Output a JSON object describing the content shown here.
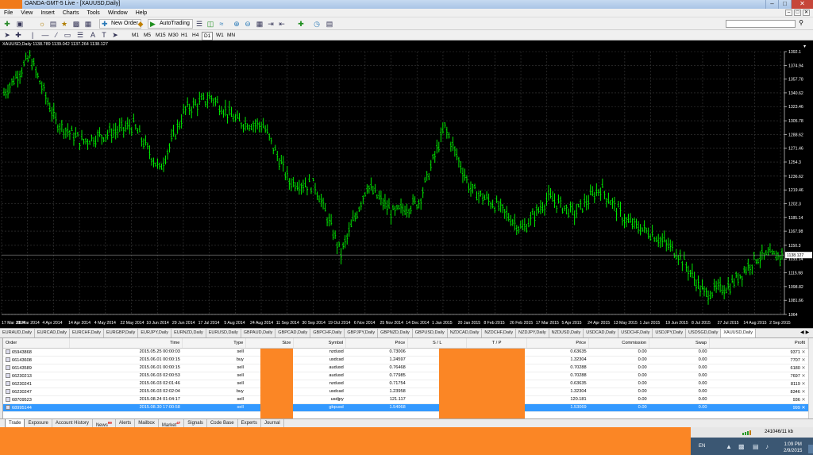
{
  "window": {
    "title": "OANDA-GMT-5 Live - [XAUUSD,Daily]"
  },
  "menu": [
    "File",
    "View",
    "Insert",
    "Charts",
    "Tools",
    "Window",
    "Help"
  ],
  "toolbar": {
    "new_order": "New Order",
    "auto_trading": "AutoTrading",
    "timeframes": [
      "M1",
      "M5",
      "M15",
      "M30",
      "H1",
      "H4",
      "D1",
      "W1",
      "MN"
    ],
    "drawing_tools": [
      "A",
      "T"
    ]
  },
  "chart": {
    "header": "XAUUSD,Daily  1138.789 1139.042 1137.264 1138.127",
    "current_price_label": "1138.127",
    "colors": {
      "background": "#000000",
      "bars": "#00ff00",
      "grid": "#3a3a3a",
      "text": "#ffffff"
    }
  },
  "chart_data": {
    "type": "line",
    "ylim": [
      1064.0,
      1392.1
    ],
    "y_ticks": [
      1392.1,
      1374.94,
      1357.78,
      1340.62,
      1323.46,
      1305.78,
      1288.62,
      1271.46,
      1254.3,
      1236.62,
      1219.46,
      1202.3,
      1185.14,
      1167.98,
      1150.3,
      1133.14,
      1115.98,
      1098.82,
      1081.66,
      1064.0
    ],
    "x_ticks": [
      "17 Mar 2014",
      "26 Mar 2014",
      "4 Apr 2014",
      "14 Apr 2014",
      "4 May 2014",
      "22 May 2014",
      "10 Jun 2014",
      "29 Jun 2014",
      "17 Jul 2014",
      "5 Aug 2014",
      "24 Aug 2014",
      "11 Sep 2014",
      "30 Sep 2014",
      "19 Oct 2014",
      "6 Nov 2014",
      "25 Nov 2014",
      "14 Dec 2014",
      "1 Jan 2015",
      "20 Jan 2015",
      "8 Feb 2015",
      "26 Feb 2015",
      "17 Mar 2015",
      "5 Apr 2015",
      "24 Apr 2015",
      "13 May 2015",
      "1 Jun 2015",
      "19 Jun 2015",
      "8 Jul 2015",
      "27 Jul 2015",
      "14 Aug 2015",
      "2 Sep 2015"
    ],
    "x": [
      0,
      2,
      4,
      6,
      8,
      10,
      12,
      14,
      16,
      18,
      20,
      22,
      24,
      26,
      28,
      30
    ],
    "values": [
      1340,
      1385,
      1305,
      1280,
      1290,
      1300,
      1245,
      1320,
      1335,
      1305,
      1300,
      1230,
      1225,
      1140,
      1225,
      1190,
      1205,
      1298,
      1220,
      1200,
      1170,
      1210,
      1190,
      1222,
      1180,
      1165,
      1140,
      1090,
      1100,
      1135,
      1138
    ],
    "grid": true,
    "current_price": 1138.127
  },
  "symbol_tabs": [
    "EURAUD,Daily",
    "EURCAD,Daily",
    "EURCHF,Daily",
    "EURGBP,Daily",
    "EURJPY,Daily",
    "EURNZD,Daily",
    "EURUSD,Daily",
    "GBPAUD,Daily",
    "GBPCAD,Daily",
    "GBPCHF,Daily",
    "GBPJPY,Daily",
    "GBPNZD,Daily",
    "GBPUSD,Daily",
    "NZDCAD,Daily",
    "NZDCHF,Daily",
    "NZDJPY,Daily",
    "NZDUSD,Daily",
    "USDCAD,Daily",
    "USDCHF,Daily",
    "USDJPY,Daily",
    "USDSGD,Daily",
    "XAUUSD,Daily"
  ],
  "orders": {
    "columns": [
      "Order",
      "Time",
      "Type",
      "Size",
      "Symbol",
      "Price",
      "S / L",
      "T / P",
      "Price",
      "Commission",
      "Swap",
      "Profit"
    ],
    "rows": [
      {
        "order": "65943868",
        "time": "2015.05.25 00:00:03",
        "type": "sell",
        "symbol": "nzdusd",
        "price": "0.73006",
        "cur_price": "0.63635",
        "commission": "0.00",
        "swap": "0.00",
        "profit": "9371"
      },
      {
        "order": "66143608",
        "time": "2015.06.01 00:00:15",
        "type": "buy",
        "symbol": "usdcad",
        "price": "1.24597",
        "cur_price": "1.32304",
        "commission": "0.00",
        "swap": "0.00",
        "profit": "7707"
      },
      {
        "order": "66143589",
        "time": "2015.06.01 00:00:15",
        "type": "sell",
        "symbol": "audusd",
        "price": "0.76468",
        "cur_price": "0.70288",
        "commission": "0.00",
        "swap": "0.00",
        "profit": "6180"
      },
      {
        "order": "66230213",
        "time": "2015.06.03 02:00:53",
        "type": "sell",
        "symbol": "audusd",
        "price": "0.77985",
        "cur_price": "0.70288",
        "commission": "0.00",
        "swap": "0.00",
        "profit": "7697"
      },
      {
        "order": "66230241",
        "time": "2015.06.03 02:01:46",
        "type": "sell",
        "symbol": "nzdusd",
        "price": "0.71754",
        "cur_price": "0.63635",
        "commission": "0.00",
        "swap": "0.00",
        "profit": "8119"
      },
      {
        "order": "66230247",
        "time": "2015.06.03 02:02:04",
        "type": "buy",
        "symbol": "usdcad",
        "price": "1.23958",
        "cur_price": "1.32304",
        "commission": "0.00",
        "swap": "0.00",
        "profit": "8346"
      },
      {
        "order": "68709523",
        "time": "2015.08.24 01:04:17",
        "type": "sell",
        "symbol": "usdjpy",
        "price": "121.117",
        "cur_price": "120.181",
        "commission": "0.00",
        "swap": "0.00",
        "profit": "936"
      },
      {
        "order": "68995144",
        "time": "2015.08.30 17:00:58",
        "type": "sell",
        "symbol": "gbpusd",
        "price": "1.54068",
        "cur_price": "1.53069",
        "commission": "0.00",
        "swap": "0.00",
        "profit": "999"
      }
    ],
    "selected_index": 7
  },
  "terminal_tabs": [
    {
      "label": "Trade",
      "badge": ""
    },
    {
      "label": "Exposure",
      "badge": ""
    },
    {
      "label": "Account History",
      "badge": ""
    },
    {
      "label": "News",
      "badge": "99"
    },
    {
      "label": "Alerts",
      "badge": ""
    },
    {
      "label": "Mailbox",
      "badge": ""
    },
    {
      "label": "Market",
      "badge": "47"
    },
    {
      "label": "Signals",
      "badge": ""
    },
    {
      "label": "Code Base",
      "badge": ""
    },
    {
      "label": "Experts",
      "badge": ""
    },
    {
      "label": "Journal",
      "badge": ""
    }
  ],
  "status": {
    "traffic": "241046/11 kb"
  },
  "tray": {
    "language": "EN",
    "time": "1:09 PM",
    "date": "2/9/2015"
  }
}
